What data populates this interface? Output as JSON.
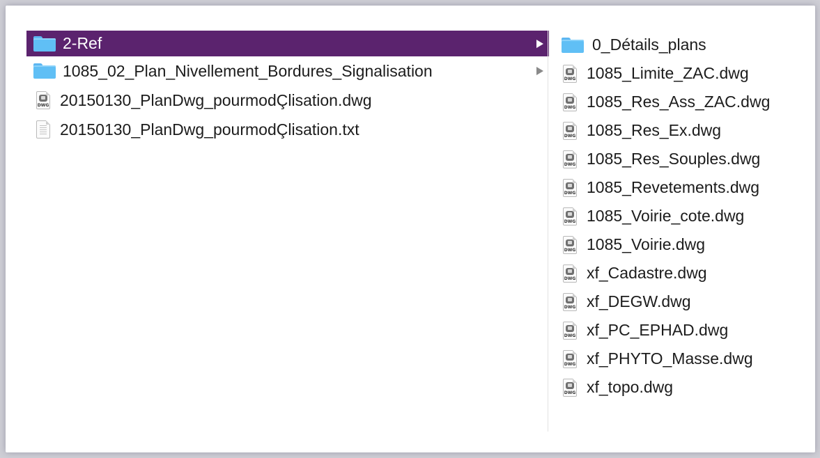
{
  "column1": {
    "items": [
      {
        "label": "2-Ref",
        "icon": "folder-icon",
        "kind": "folder",
        "selected": true
      },
      {
        "label": "1085_02_Plan_Nivellement_Bordures_Signalisation",
        "icon": "folder-icon",
        "kind": "folder",
        "selected": false
      },
      {
        "label": "20150130_PlanDwg_pourmodÇlisation.dwg",
        "icon": "dwg-file-icon",
        "kind": "dwg"
      },
      {
        "label": "20150130_PlanDwg_pourmodÇlisation.txt",
        "icon": "text-file-icon",
        "kind": "txt"
      }
    ]
  },
  "column2": {
    "items": [
      {
        "label": "0_Détails_plans",
        "icon": "folder-icon"
      },
      {
        "label": "1085_Limite_ZAC.dwg",
        "icon": "dwg-file-icon"
      },
      {
        "label": "1085_Res_Ass_ZAC.dwg",
        "icon": "dwg-file-icon"
      },
      {
        "label": "1085_Res_Ex.dwg",
        "icon": "dwg-file-icon"
      },
      {
        "label": "1085_Res_Souples.dwg",
        "icon": "dwg-file-icon"
      },
      {
        "label": "1085_Revetements.dwg",
        "icon": "dwg-file-icon"
      },
      {
        "label": "1085_Voirie_cote.dwg",
        "icon": "dwg-file-icon"
      },
      {
        "label": "1085_Voirie.dwg",
        "icon": "dwg-file-icon"
      },
      {
        "label": "xf_Cadastre.dwg",
        "icon": "dwg-file-icon"
      },
      {
        "label": "xf_DEGW.dwg",
        "icon": "dwg-file-icon"
      },
      {
        "label": "xf_PC_EPHAD.dwg",
        "icon": "dwg-file-icon"
      },
      {
        "label": "xf_PHYTO_Masse.dwg",
        "icon": "dwg-file-icon"
      },
      {
        "label": "xf_topo.dwg",
        "icon": "dwg-file-icon"
      }
    ]
  },
  "dwg_badge_text": "DWG",
  "colors": {
    "selection": "#5b236e",
    "folder": "#60bff5",
    "background": "#ffffff"
  }
}
